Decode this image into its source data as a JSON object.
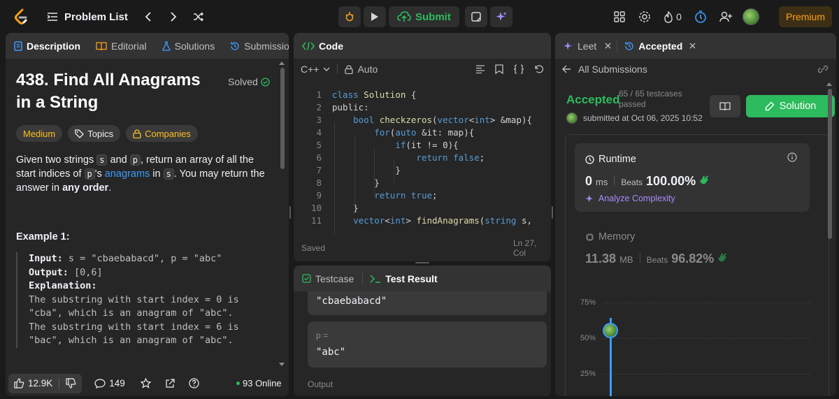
{
  "nav": {
    "problem_list": "Problem List",
    "submit_label": "Submit",
    "streak_count": "0",
    "premium_label": "Premium"
  },
  "description": {
    "tabs": [
      "Description",
      "Editorial",
      "Solutions",
      "Submission"
    ],
    "title": "438. Find All Anagrams in a String",
    "status": "Solved",
    "difficulty": "Medium",
    "topics_label": "Topics",
    "companies_label": "Companies",
    "text_part1": "Given two strings ",
    "s_code": "s",
    "text_and": " and ",
    "p_code": "p",
    "text_part2": ", return an array of all the start indices of ",
    "text_part3": "'s ",
    "anagrams_link": "anagrams",
    "text_in": " in ",
    "text_part4": ". You may return the answer in ",
    "any_order": "any order",
    "period": ".",
    "example_title": "Example 1:",
    "example_input_label": "Input:",
    "example_input": " s = \"cbaebabacd\", p = \"abc\"",
    "example_output_label": "Output:",
    "example_output": " [0,6]",
    "example_expl_label": "Explanation:",
    "example_expl": "The substring with start index = 0 is\n\"cba\", which is an anagram of \"abc\".\nThe substring with start index = 6 is\n\"bac\", which is an anagram of \"abc\".",
    "likes": "12.9K",
    "comments": "149",
    "online": "93 Online"
  },
  "code": {
    "tab": "Code",
    "language": "C++",
    "mode": "Auto",
    "saved": "Saved",
    "cursor": "Ln 27, Col",
    "lines": [
      "class Solution {",
      "public:",
      "    bool checkzeros(vector<int> &map){",
      "        for(auto &it: map){",
      "            if(it != 0){",
      "                return false;",
      "            }",
      "        }",
      "        return true;",
      "    }",
      "    vector<int> findAnagrams(string s,"
    ]
  },
  "testcase": {
    "tab_testcase": "Testcase",
    "tab_result": "Test Result",
    "value_s": "\"cbaebabacd\"",
    "label_p": "p =",
    "value_p": "\"abc\"",
    "output_label": "Output"
  },
  "submission": {
    "tab_leet": "Leet",
    "tab_accepted": "Accepted",
    "back_label": "All Submissions",
    "status": "Accepted",
    "testcases": "65 / 65 testcases passed",
    "submitted": "submitted at Oct 06, 2025 10:52",
    "solution_label": "Solution",
    "runtime_label": "Runtime",
    "runtime_value": "0",
    "runtime_unit": "ms",
    "beats_label": "Beats",
    "runtime_beats": "100.00%",
    "analyze_label": "Analyze Complexity",
    "memory_label": "Memory",
    "memory_value": "11.38",
    "memory_unit": "MB",
    "memory_beats": "96.82%",
    "chart_ticks": [
      "75%",
      "50%",
      "25%"
    ]
  },
  "colors": {
    "accent_green": "#2cbb5d",
    "accent_orange": "#ffa116",
    "medium": "#ffc01e",
    "link": "#3b9dff"
  }
}
